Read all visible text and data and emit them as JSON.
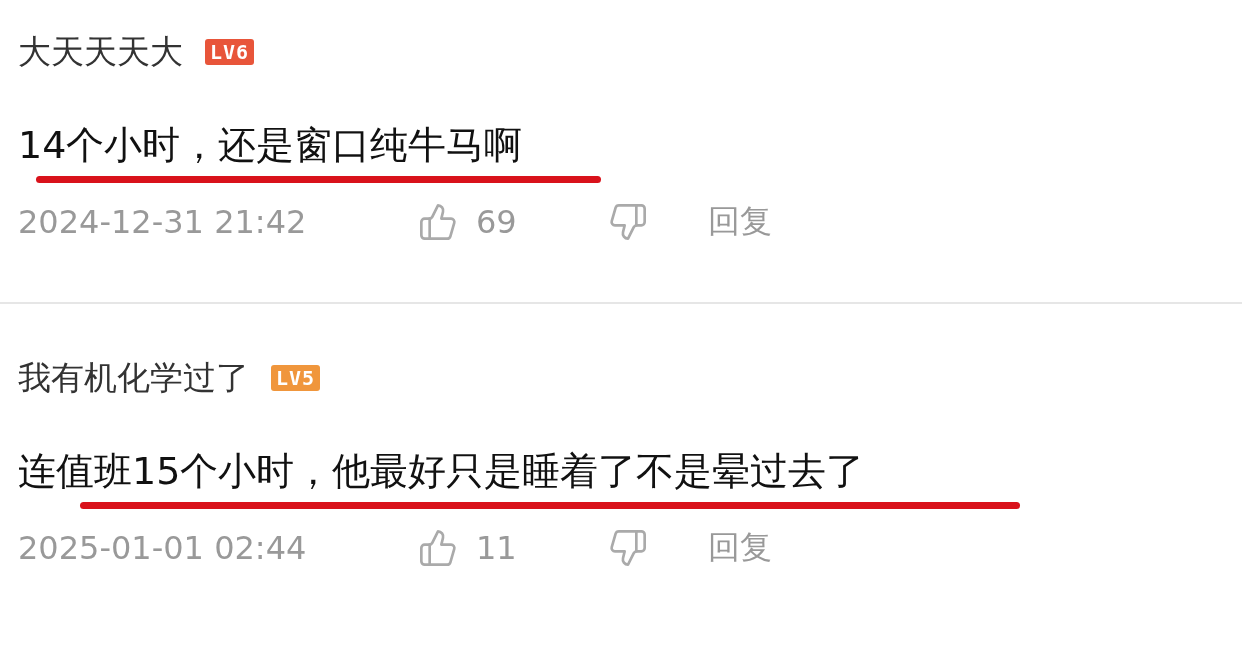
{
  "comments": [
    {
      "username": "大天天天大",
      "level_badge": "LV6",
      "color": "#e8553a",
      "text": "14个小时，还是窗口纯牛马啊",
      "underlined": true,
      "time": "2024-12-31 21:42",
      "likes": "69",
      "reply": "回复"
    },
    {
      "username": "我有机化学过了",
      "level_badge": "LV5",
      "color": "#f0963c",
      "text": "连值班15个小时，他最好只是睡着了不是晕过去了",
      "underlined": true,
      "time": "2025-01-01 02:44",
      "likes": "11",
      "reply": "回复"
    }
  ]
}
